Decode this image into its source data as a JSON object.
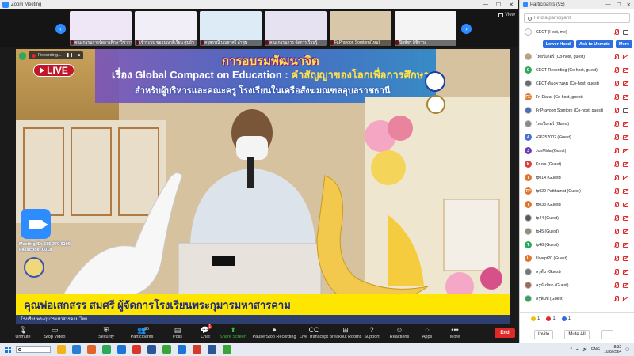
{
  "window": {
    "title": "Zoom Meeting",
    "view_label": "View"
  },
  "gallery": {
    "tiles": [
      {
        "name": "คณะกรรมการจัดการศึกษาวิชาการ",
        "bg": "#efe6f6"
      },
      {
        "name": "เข้าระบบ ขออนุญาติเรียน ศูนย์ฯ",
        "bg": "#f2eef8"
      },
      {
        "name": "ครูพรรณี บุญชาศรี ลำพูน",
        "bg": "#dcebf5"
      },
      {
        "name": "คณะกรรมการ จัดการเรียนรู้",
        "bg": "#e7e2f1"
      },
      {
        "name": "Fr.Prayoon Somtorn(ไหม)",
        "bg": "#d8c7a8"
      },
      {
        "name": "ปิยพัชร อิชิการะ",
        "bg": "#f4f4f4"
      }
    ]
  },
  "video": {
    "recording_label": "Recording...",
    "live_label": "LIVE",
    "title_line1": "การอบรมพัฒนาจิต",
    "title_line2_prefix": "เรื่อง Global Compact on Education :",
    "title_line2_hl": "คำสัญญาของโลกเพื่อการศึกษา",
    "title_line3": "สำหรับผู้บริหารและคณะครู โรงเรียนในเครือสังฆมณฑลอุบลราชธานี",
    "meeting_id_line1": "Meeting ID: 585 370 6199",
    "meeting_id_line2": "Passcode: 0018",
    "caption": "คุณพ่อเสกสรร  สมศรี  ผู้จัดการโรงเรียนพระกุมารมหาสารคาม",
    "subcaption": "โรงเรียนพระกุมารมหาสารคาม ไทย"
  },
  "toolbar": {
    "items": [
      {
        "label": "Unmute",
        "icon": "mic-off-icon",
        "glyph": "🎙"
      },
      {
        "label": "Stop Video",
        "icon": "video-icon",
        "glyph": "▭"
      },
      {
        "label": "Security",
        "icon": "shield-icon",
        "glyph": "⛨"
      },
      {
        "label": "Participants",
        "icon": "participants-icon",
        "glyph": "👥",
        "count": "95"
      },
      {
        "label": "Polls",
        "icon": "polls-icon",
        "glyph": "▤"
      },
      {
        "label": "Chat",
        "icon": "chat-icon",
        "glyph": "💬",
        "badge": "1"
      },
      {
        "label": "Share Screen",
        "icon": "share-screen-icon",
        "glyph": "⬆",
        "green": true
      },
      {
        "label": "Pause/Stop Recording",
        "icon": "recording-icon",
        "glyph": "⏺"
      },
      {
        "label": "Live Transcript",
        "icon": "transcript-icon",
        "glyph": "CC"
      },
      {
        "label": "Breakout Rooms",
        "icon": "breakout-icon",
        "glyph": "⊞"
      },
      {
        "label": "Support",
        "icon": "support-icon",
        "glyph": "?"
      },
      {
        "label": "Reactions",
        "icon": "reactions-icon",
        "glyph": "☺"
      },
      {
        "label": "Apps",
        "icon": "apps-icon",
        "glyph": "⁘"
      },
      {
        "label": "More",
        "icon": "more-icon",
        "glyph": "•••"
      }
    ],
    "end_label": "End"
  },
  "panel": {
    "title": "Participants (95)",
    "search_placeholder": "Find a participant",
    "lower_hand": "Lower Hand",
    "ask_unmute": "Ask to Unmute",
    "more_label": "More",
    "participants": [
      {
        "name": "CECT (Host, me)",
        "initial": "",
        "color": "#ffffff",
        "video": true,
        "muted": true,
        "photo": true
      },
      {
        "name": "ไทยปีเตอร์ (Co-host, guest)",
        "initial": "",
        "color": "#b7a36d",
        "video": false,
        "muted": true,
        "photo": true
      },
      {
        "name": "CECT-Recording (Co-host, guest)",
        "initial": "C",
        "color": "#2ea85a",
        "video": false,
        "muted": true
      },
      {
        "name": "CECT-ห้องควบคุม (Co-host, guest)",
        "initial": "",
        "color": "#6c6c6c",
        "video": false,
        "muted": true,
        "photo": true
      },
      {
        "name": "Fr. Eiarat (Co-host, guest)",
        "initial": "FE",
        "color": "#e07a2e",
        "video": false,
        "muted": true
      },
      {
        "name": "Fr.Prayoon Somtorn (Co-host, guest)",
        "initial": "",
        "color": "#4a6fb5",
        "video": true,
        "muted": true,
        "photo": true
      },
      {
        "name": "ไทยปีเตอร์ (Guest)",
        "initial": "",
        "color": "#8a8a8a",
        "video": false,
        "muted": true,
        "photo": true
      },
      {
        "name": "426257002 (Guest)",
        "initial": "4",
        "color": "#4a6fd0",
        "video": false,
        "muted": true
      },
      {
        "name": "JonMida (Guest)",
        "initial": "J",
        "color": "#6a3fb5",
        "video": false,
        "muted": true
      },
      {
        "name": "Krusa (Guest)",
        "initial": "K",
        "color": "#d94040",
        "video": false,
        "muted": true
      },
      {
        "name": "tp014 (Guest)",
        "initial": "T",
        "color": "#e0762e",
        "video": false,
        "muted": true
      },
      {
        "name": "tp020 Patthamat (Guest)",
        "initial": "TP",
        "color": "#e0762e",
        "video": false,
        "muted": true
      },
      {
        "name": "tp033 (Guest)",
        "initial": "T",
        "color": "#e0762e",
        "video": false,
        "muted": true
      },
      {
        "name": "tp44 (Guest)",
        "initial": "",
        "color": "#5a5a5a",
        "video": false,
        "muted": true,
        "photo": true
      },
      {
        "name": "tp45 (Guest)",
        "initial": "",
        "color": "#9a8a7a",
        "video": false,
        "muted": true,
        "photo": true
      },
      {
        "name": "tp48 (Guest)",
        "initial": "T",
        "color": "#2ea85a",
        "video": false,
        "muted": true
      },
      {
        "name": "Userpt20 (Guest)",
        "initial": "U",
        "color": "#e0762e",
        "video": false,
        "muted": true
      },
      {
        "name": "ครูตั้ม (Guest)",
        "initial": "",
        "color": "#777777",
        "video": false,
        "muted": true,
        "photo": true
      },
      {
        "name": "ครูนันทิยา (Guest)",
        "initial": "",
        "color": "#a06a5a",
        "video": false,
        "muted": true,
        "photo": true
      },
      {
        "name": "ครูพิมพ์ (Guest)",
        "initial": "",
        "color": "#2ea85a",
        "video": false,
        "muted": true,
        "photo": true
      }
    ],
    "reactions": [
      {
        "count": "1",
        "color": "#f2c200"
      },
      {
        "count": "1",
        "color": "#e02828"
      },
      {
        "count": "1",
        "color": "#2d6fe0"
      }
    ],
    "invite_label": "Invite",
    "mute_all_label": "Mute All"
  },
  "taskbar": {
    "time": "8:32",
    "date": "10/8/2564",
    "lang": "ENG",
    "apps": [
      "#f3b21d",
      "#2b7cd3",
      "#e4632b",
      "#2ea85a",
      "#1e73d8",
      "#d9372b",
      "#2a5699",
      "#3aa33a",
      "#1e73d8",
      "#d33a2c",
      "#2a5699",
      "#3aa33a"
    ]
  }
}
